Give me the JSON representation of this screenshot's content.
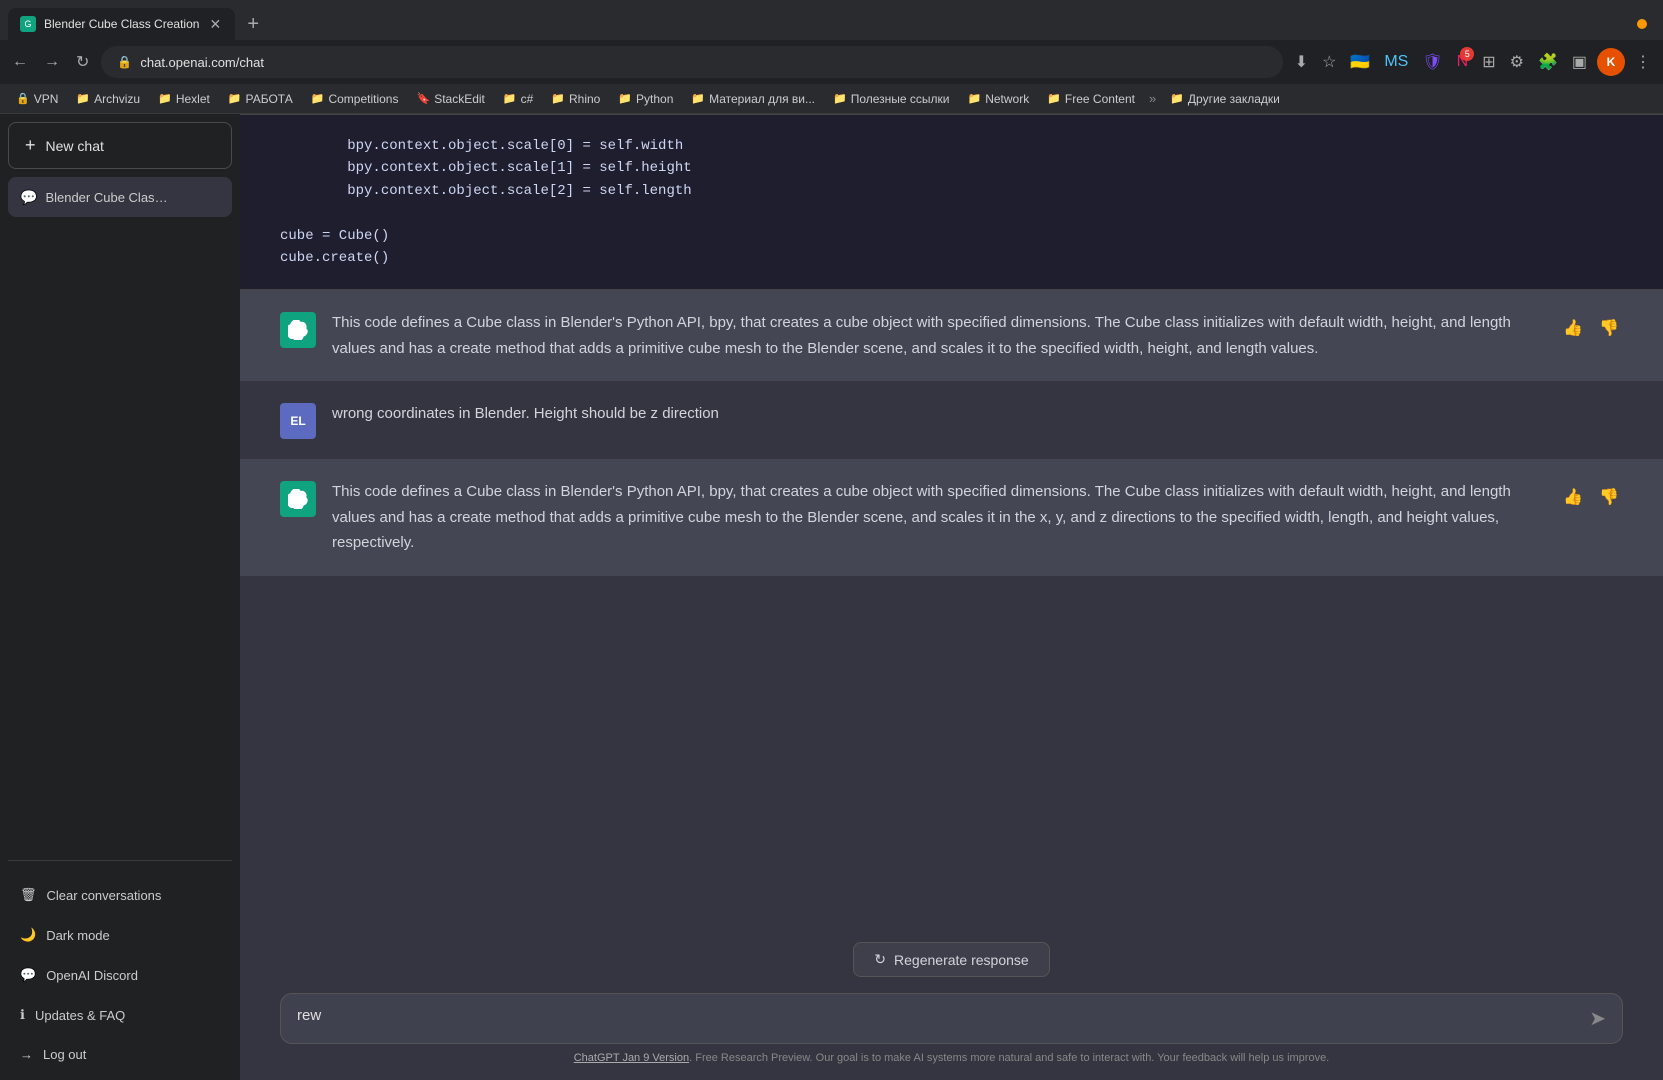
{
  "browser": {
    "tab_title": "Blender Cube Class Creation",
    "tab_favicon": "G",
    "url": "chat.openai.com/chat",
    "new_tab_label": "+",
    "close_tab_label": "✕",
    "nav_back": "←",
    "nav_forward": "→",
    "nav_refresh": "↻",
    "lock_icon": "🔒"
  },
  "bookmarks": [
    {
      "label": "VPN",
      "icon": "🔒"
    },
    {
      "label": "Archvizu",
      "icon": "📁"
    },
    {
      "label": "Hexlet",
      "icon": "📁"
    },
    {
      "label": "РАБОТА",
      "icon": "📁"
    },
    {
      "label": "Competitions",
      "icon": "📁"
    },
    {
      "label": "StackEdit",
      "icon": "🔖"
    },
    {
      "label": "c#",
      "icon": "📁"
    },
    {
      "label": "Rhino",
      "icon": "📁"
    },
    {
      "label": "Python",
      "icon": "📁"
    },
    {
      "label": "Материал для ви...",
      "icon": "📁"
    },
    {
      "label": "Полезные ссылки",
      "icon": "📁"
    },
    {
      "label": "Network",
      "icon": "📁"
    },
    {
      "label": "Free Content",
      "icon": "📁"
    },
    {
      "label": "Другие закладки",
      "icon": "📁"
    }
  ],
  "sidebar": {
    "new_chat_label": "New chat",
    "new_chat_icon": "+",
    "conversations": [
      {
        "title": "Blender Cube Class Cr",
        "icon": "💬"
      }
    ],
    "bottom_items": [
      {
        "label": "Clear conversations",
        "icon": "🗑"
      },
      {
        "label": "Dark mode",
        "icon": "🌙"
      },
      {
        "label": "OpenAI Discord",
        "icon": "💬"
      },
      {
        "label": "Updates & FAQ",
        "icon": "ℹ"
      },
      {
        "label": "Log out",
        "icon": "→"
      }
    ]
  },
  "chat": {
    "code_lines": [
      "        bpy.context.object.scale[0] = self.width",
      "        bpy.context.object.scale[1] = self.height",
      "        bpy.context.object.scale[2] = self.length",
      "",
      "cube = Cube()",
      "cube.create()"
    ],
    "messages": [
      {
        "role": "assistant",
        "avatar_label": "G",
        "text": "This code defines a Cube class in Blender's Python API, bpy, that creates a cube object with specified dimensions. The Cube class initializes with default width, height, and length values and has a create method that adds a primitive cube mesh to the Blender scene, and scales it to the specified width, height, and length values."
      },
      {
        "role": "user",
        "avatar_label": "EL",
        "text": "wrong coordinates in Blender. Height should be z direction"
      },
      {
        "role": "assistant",
        "avatar_label": "G",
        "text": "This code defines a Cube class in Blender's Python API, bpy, that creates a cube object with specified dimensions. The Cube class initializes with default width, height, and length values and has a create method that adds a primitive cube mesh to the Blender scene, and scales it in the x, y, and z directions to the specified width, length, and height values, respectively."
      }
    ],
    "regenerate_label": "Regenerate response",
    "regenerate_icon": "↻",
    "input_value": "rew",
    "input_placeholder": "",
    "send_icon": "➤",
    "footer_text": "ChatGPT Jan 9 Version",
    "footer_desc": ". Free Research Preview. Our goal is to make AI systems more natural and safe to interact with. Your feedback will help us improve.",
    "footer_link": "ChatGPT Jan 9 Version"
  },
  "colors": {
    "accent": "#10a37f",
    "sidebar_bg": "#202123",
    "chat_bg": "#343541",
    "assistant_bg": "#444654",
    "user_avatar_bg": "#5c6bc0",
    "code_bg": "#1e1e2e"
  }
}
